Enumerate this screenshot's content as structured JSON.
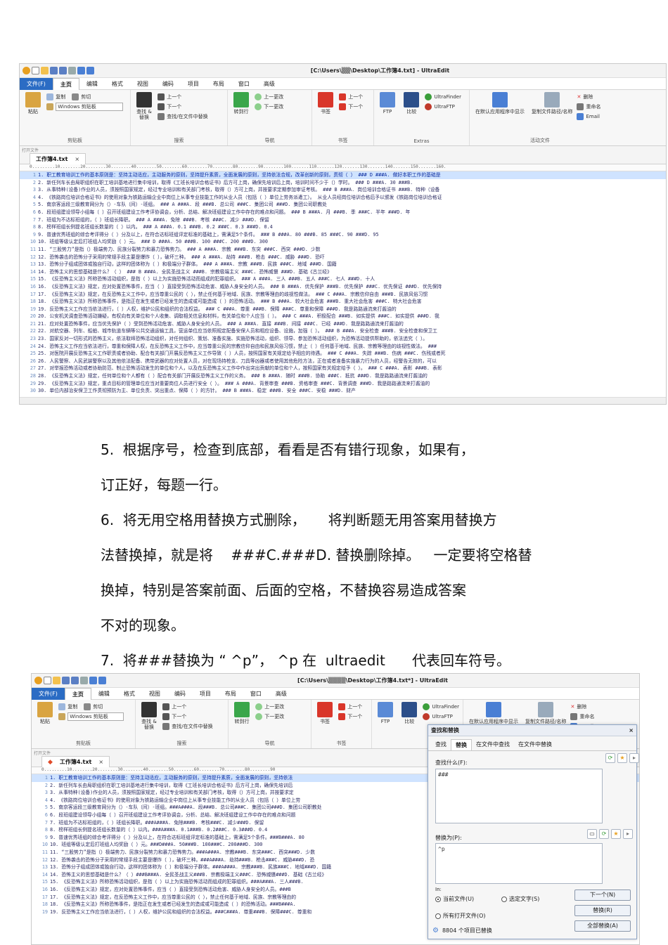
{
  "shot1": {
    "title": "[C:\\Users\\▒▒\\Desktop\\工作簿4.txt] - UltraEdit",
    "menu": [
      "文件(F)",
      "主页",
      "编辑",
      "格式",
      "视图",
      "编码",
      "项目",
      "布局",
      "窗口",
      "高级"
    ],
    "active_menu": "主页",
    "ribbon": {
      "clipboard": {
        "paste": "粘贴",
        "copy": "复制",
        "cut": "剪切",
        "combo": "Windows 剪贴板",
        "group": "剪贴板"
      },
      "search": {
        "find_replace": "查找 & 替换",
        "up": "上一个",
        "down": "下一个",
        "find_in_files": "查找/在文件中替换",
        "group": "搜索"
      },
      "nav": {
        "goto": "转到行",
        "prev_edit": "上一更改",
        "next_edit": "下一更改",
        "group": "导航"
      },
      "bookmarks": {
        "bookmark": "书签",
        "prev": "上一个",
        "next": "下一个",
        "group": "书签"
      },
      "extras": {
        "ftp": "FTP",
        "compare": "比较",
        "finder": "UltraFinder",
        "uftp": "UltraFTP",
        "group": "Extras"
      },
      "active_file": {
        "open_default": "在默认应用程序中显示",
        "copy_path": "复制文件路径/名称",
        "delete": "删除",
        "rename": "重命名",
        "email": "Email",
        "group": "活动文件"
      }
    },
    "open_files_label": "打开文件",
    "tab_name": "工作簿4.txt",
    "tab_close": "×",
    "ruler": "0.........10........20........30........40........50........60........70........80........90........100.......110.......120.......130.......140.......150.......160.",
    "lines": [
      "1. 职工教育培训工作的基本原则是：坚持主动适应，主动服务的原则，坚持提升素质，全面发展的原则，坚持依法合规，改革创新的原则，贯彻（ ） ### D ###A. 做好本职工作的基础是",
      "2. 新任列车长由局职组织在职工培训基地进行集中培训，取得《工班长培训合格证书》后方可上岗，确保先培训后上岗，培训时间不少于（）学时。 ### D ###A. 30 ###B.",
      "3. 从事特种(设备)作业的人员，须按照国家规定，经过专业培训和有关部门考核，取得（）方可上岗，并按要求定期参加审证考核。 ### B ###A. 岗位培训合格证书 ###B. 特种（设备",
      "4. 《铁路岗位培训合格证书》的使用对象为铁路运输企业中岗位上从事专业技能工作的从业人员（包括（ ）单位上劳务派遣工）。 从业人员经岗位培训合格后予以颁发《铁路岗位培训合格证",
      "5. 南京客运段三级教育网分为（）-车队（间）-班组。 ### A ###A. 段 ###B. 总公司 ###C. 集团公司 ###D. 集团公司职教处",
      "6. 段班组建设领导小组每（ ）召开班组建设工作考评协调会，分析、总结、解决班组建设工作中存在的难点和问题。 ### B ###A. 月 ###B. 季 ###C. 半年 ###D. 年",
      "7. 班组为不达标班组的，（ ）班组长降职。 ### A ###A. 免除 ###B. 考核 ###C. 减少 ###D. 保留",
      "8. 榜样班组长例提名班组长数量的（ ）以内。 ### A ###A. 0.1 ###B. 0.2 ###C. 0.3 ###D. 0.4",
      "9. 普速优秀班组的综合考评得分（ ）分及以上，在符合达标班组评定标准的基础上，需满足5个条件。 ### B ###A. 80 ###B. 85 ###C. 90 ###D. 95",
      "10. 班组等级认定后打班组人均奖励（ ）元。 ### D ###A. 50 ###B. 100 ###C. 200 ###D. 300",
      "11. “三股势力”是指（）极端势力、民族分裂势力和暴力恐怖势力。 ### A ###A. 宗教 ###B. 东突 ###C. 西突 ###D. 少数",
      "12. 恐怖袭击的恐怖分子采用的常规手段主要是爆炸（ ），破坏三种。 ### A ###A. 劫持 ###B. 枪击 ###C. 威胁 ###D. 恐吓",
      "13. 恐怖分子组成团体或独自行动，这样的团体称为（ ）和极端分子群体。 ### A ###A. 宗教 ###B. 民族 ###C. 地域 ###D. 国籍",
      "14. 恐怖主义的思想基础是什么？（ ） ### B ###A. 全民圣战主义 ###B. 宗教极端主义 ###C. 恐怖威慑 ###D. 基础《古兰经》",
      "15. 《反恐怖主义法》所称恐怖活动组织，是指（ ）以上为实施恐怖活动而组成的犯罪组织。 ### A ###A. 三人 ###B. 五人 ###C. 七人 ###D. 十人",
      "16. 《反恐怖主义法》规定，应对处置恐怖事件，应当（ ）直接受到恐怖活动危害、威胁人身安全的人员。 ### B ###A. 优先保护 ###B. 优先保护 ###C. 优先保证 ###D. 优先保持",
      "17. 《反恐怖主义法》规定，在反恐怖主义工作中，应当尊重公民的（ ），禁止任何基于地域、民族、宗教等理由的歧视性做法。 ### C ###A. 宗教信仰自由 ###B. 民族风俗习惯",
      "18. 《反恐怖主义法》所称恐怖事件，是指正在发生或者已经发生的造成或可能造成（ ）的恐怖活动。 ### B ###A. 较大社会危害 ###B. 重大社会危害 ###C. 特大社会危害",
      "19. 反恐怖主义工作应当依法进行，（ ）人权，维护公民和组织的合法权益。 ### C ###A. 尊重 ###B. 保障 ###C. 尊重和保障 ###D. 我是路路通流来打酱油的",
      "20. 公安机关调查恐怖活动嫌疑，有权向有关单位和个人收集、调取相关信息和材料，有关单位和个人应当（ ）。 ### C ###A. 积极配合 ###B. 如实提供 ###C. 如实提供 ###D. 我",
      "21. 应对处置恐怖事件，应当优先保护（ ）受到恐怖活动危害、威胁人身安全的人员。 ### A ###A. 直接 ###B. 间接 ###C. 已经 ###D. 我是路路通流来打酱油的",
      "22. 对航空器、列车、船舶、城市轨道车辆等公共交通运输工具，营运单位应当依照规定配备安保人员和相应设备、设施，加强（ ）。 ### B ###A. 安全检查 ###B. 安全检查和保卫工",
      "23. 国家反对一切形式的恐怖主义，依法取缔恐怖活动组织，对任何组织、策划、准备实施、实施恐怖活动，组织、领导、参加恐怖活动组织，为恐怖活动提供帮助的，依法追究（ ）。",
      "24. 恐怖主义工作应当依法进行，尊重和保障人权，在反恐怖主义工作中，应当尊重公民的宗教信仰自由和民族风俗习惯，禁止（ ）任何基于地域、民族、宗教等理由的歧视性做法。 ###",
      "25. 对医院开展反恐怖主义工作职责或者协助、配合有关部门开展反恐怖主义工作导致（ ）人员，按照国家有关规定给予相应的待遇。 ### C ###A. 失踪 ###B. 伤病 ###C. 伤残或者死",
      "26. 人民警察、人民武装警察以及其他依法配备、携带武器的应对处置人员，对在现场持枪支、刀具等凶器或者使用其他危险方法，正在或者准备实施暴力行为的人员，经警告无效的，可以",
      "27. 对举报恐怖活动或者协助防范、制止恐怖活动发生的单位和个人，以及在反恐怖主义工作中作出突出贡献的单位和个人，按照国家有关规定给予（ ）。 ### C ###A. 表彰 ###B. 表彰",
      "28. 《反恐怖主义法》规定，任何单位和个人都有（ ）配合有关部门开展反恐怖主义工作的义务。 ### B ###A. 随时 ###B. 协助 ###C. 抵抗 ###D. 我是路路通流来打酱油的",
      "29. 《反恐怖主义法》规定，重点目标的管理单位应当对重要岗位人员进行安全（ ）。 ### A ###A. 背景审查 ###B. 资格审查 ###C. 背景调查 ###D. 我是路路通流来打酱油的",
      "30. 单位内部治安保卫工作贯彻预防为主、单位负责、突出重点、保障（ ）的方针。 ### B ###A. 稳定 ###B. 安全 ###C. 安稳 ###D. 财产"
    ]
  },
  "text": {
    "p5_line1": "5.  根据序号，检查到底部，看看是否有错行现象，如果有，",
    "p5_line2": "订正好，每题一行。",
    "p6_line1": "6.  将无用空格用替换方式删除，     将判断题无用答案用替换方",
    "p6_line2": "法替换掉，就是将    ###C.###D. 替换删除掉。   一定要将空格替",
    "p6_line3": "换掉，特别是答案前面、后面的空格，不替换容易造成答案",
    "p6_line4": "不对的现象。",
    "p7_line1": "7.  将###替换为 “ ^p”， ^p 在  ultraedit      代表回车符号。"
  },
  "shot2": {
    "title": "[C:\\Users\\▒▒▒▒\\Desktop\\工作簿4.txt*] - UltraEdit",
    "tab_name": "工作簿4.txt",
    "tab_close": "×",
    "ruler": "0.........10........20........30........40........50........60........70........80........90",
    "lines": [
      "1. 职工教育培训工作的基本原则是：坚持主动适应，主动服务的原则，坚持提升素质，全面发展的原则，坚持依法",
      "2. 新任列车长由局职组织在职工培训基地进行集中培训，取得《工班长培训合格证书》后方可上岗，确保先培训后",
      "3. 从事特种(设备)作业的人员，须按照国家规定，经过专业培训和有关部门考核，取得（）方可上岗，并按要求定",
      "4. 《铁路岗位培训合格证书》的使用对象为铁路运输企业中岗位上从事专业技能工作的从业人员（包括（ ）单位上劳",
      "5. 南京客运段三级教育网分为（）-车队（间）-班组。###A###A. 段###B. 总公司###C. 集团公司###D. 集团公司职教处",
      "6. 段班组建设领导小组每（ ）召开班组建设工作考评协调会，分析、总结、解决班组建设工作中存在的难点和问题",
      "7. 班组为不达标班组的，（ ）班组长降职。###A###A. 免除###B. 考核###C. 减少###D. 保留",
      "8. 榜样班组长例提名班组长数量的（ ）以内。###A###A. 0.1###B. 0.2###C. 0.3###D. 0.4",
      "9. 普速优秀班组的综合考评得分（ ）分及以上，在符合达标班组评定标准的基础上，需满足5个条件。###B###A. 80",
      "10. 班组等级认定后打班组人均奖励（ ）元。###D###A. 50###B. 100###C. 200###D. 300",
      "11. “三股势力”是指（）极端势力、民族分裂势力和暴力恐怖势力。###A###A. 宗教###B. 东突###C. 西突###D. 少数",
      "12. 恐怖袭击的恐怖分子采用的常规手段主要是爆炸（ ），破坏三种。###A###A. 劫持###B. 枪击###C. 威胁###D. 恐",
      "13. 恐怖分子组成团体或独自行动，这样的团体称为（ ）和极端分子群体。###A###A. 宗教###B. 民族###C. 地域###D. 国籍",
      "14. 恐怖主义的思想基础是什么？（ ）###B###A. 全民圣战主义###B. 宗教极端主义###C. 恐怖威慑###D. 基础《古兰经》",
      "15. 《反恐怖主义法》所称恐怖活动组织，是指（ ）以上为实施恐怖活动而组成的犯罪组织。###A###A. 三人###B.",
      "16. 《反恐怖主义法》规定，应对处置恐怖事件，应当（ ）直接受到恐怖活动危害、威胁人身安全的人员。###B",
      "17. 《反恐怖主义法》规定，在反恐怖主义工作中，应当尊重公民的（ ），禁止任何基于地域、民族、宗教等理由的",
      "18. 《反恐怖主义法》所称恐怖事件，是指正在发生或者已经发生的造成或可能造成（ ）的恐怖活动。###B###A.",
      "19. 反恐怖主义工作应当依法进行，（ ）人权，维护公民和组织的合法权益。###C###A. 尊重###B. 保障###C. 尊重和"
    ],
    "dialog": {
      "title": "查找和替换",
      "close": "×",
      "tabs": [
        "查找",
        "替换",
        "在文件中查找",
        "在文件中替换"
      ],
      "active_tab": "替换",
      "find_label": "查找什么(F):",
      "find_value": "###",
      "replace_label": "替换为(P):",
      "replace_value": "^p",
      "in_label": "In:",
      "opt_current": "当前文件(U)",
      "opt_selection": "选定文字(S)",
      "opt_all_open": "所有打开文件(O)",
      "btn_next": "下一个(N)",
      "btn_replace": "替换(R)",
      "btn_replace_all": "全部替换(A)",
      "status": "8804 个项目已替换"
    }
  }
}
